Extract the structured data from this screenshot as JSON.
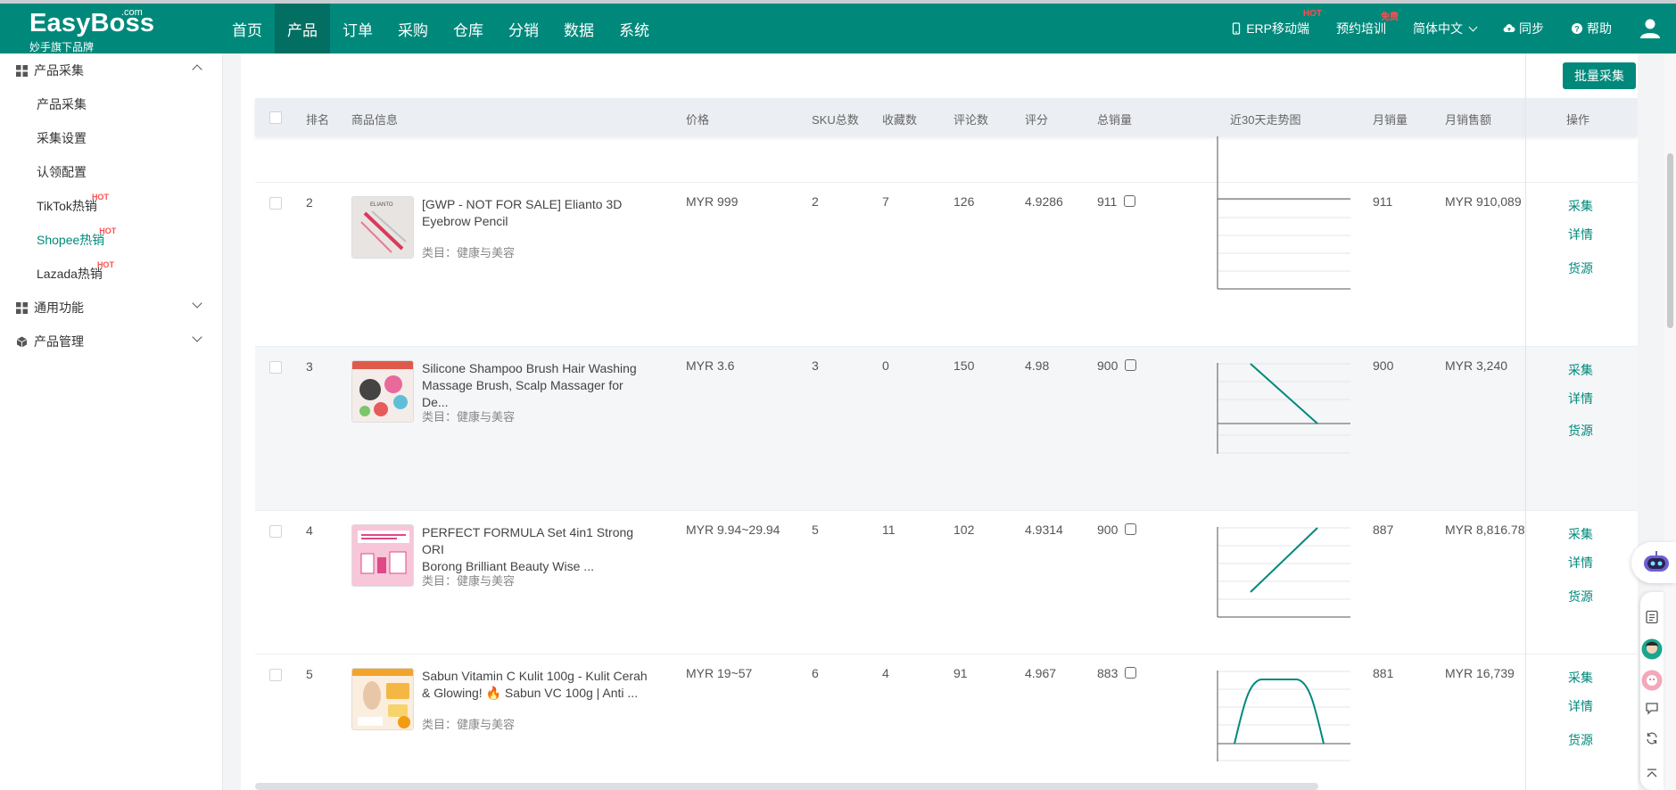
{
  "logo": {
    "brand": "EasyBoss",
    "dotcom": ".com",
    "slogan": "妙手旗下品牌"
  },
  "nav": [
    "首页",
    "产品",
    "订单",
    "采购",
    "仓库",
    "分销",
    "数据",
    "系统"
  ],
  "nav_active": "产品",
  "top_right": {
    "erp": "ERP移动端",
    "erp_badge": "HOT",
    "training": "预约培训",
    "training_badge": "免费",
    "language": "简体中文",
    "sync": "同步",
    "help": "帮助"
  },
  "sidebar": {
    "group1": "产品采集",
    "items": [
      {
        "label": "产品采集"
      },
      {
        "label": "采集设置"
      },
      {
        "label": "认领配置"
      },
      {
        "label": "TikTok热销",
        "badge": "HOT"
      },
      {
        "label": "Shopee热销",
        "badge": "HOT"
      },
      {
        "label": "Lazada热销",
        "badge": "HOT"
      }
    ],
    "group2": "通用功能",
    "group3": "产品管理"
  },
  "toolbar": {
    "batch_label": "批量采集"
  },
  "table": {
    "headers": {
      "rank": "排名",
      "info": "商品信息",
      "price": "价格",
      "sku": "SKU总数",
      "fav": "收藏数",
      "reviews": "评论数",
      "rating": "评分",
      "total_sales": "总销量",
      "trend": "近30天走势图",
      "monthly_sales": "月销量",
      "monthly_revenue": "月销售额",
      "ops": "操作"
    },
    "ops": {
      "collect": "采集",
      "detail": "详情",
      "source": "货源"
    },
    "category_prefix": "类目：",
    "rows": [
      {
        "rank": "2",
        "title1": "[GWP - NOT FOR SALE] Elianto 3D",
        "title2": "Eyebrow Pencil",
        "category": "健康与美容",
        "price": "MYR 999",
        "sku": "2",
        "fav": "7",
        "reviews": "126",
        "rating": "4.9286",
        "total_sales": "911",
        "monthly_sales": "911",
        "monthly_revenue": "MYR 910,089"
      },
      {
        "rank": "3",
        "title1": "Silicone Shampoo Brush Hair Washing",
        "title2": "Massage Brush, Scalp Massager for De...",
        "category": "健康与美容",
        "price": "MYR 3.6",
        "sku": "3",
        "fav": "0",
        "reviews": "150",
        "rating": "4.98",
        "total_sales": "900",
        "monthly_sales": "900",
        "monthly_revenue": "MYR 3,240"
      },
      {
        "rank": "4",
        "title1": "PERFECT FORMULA Set 4in1 Strong ORI",
        "title2": "Borong Brilliant Beauty Wise ...",
        "category": "健康与美容",
        "price": "MYR 9.94~29.94",
        "sku": "5",
        "fav": "11",
        "reviews": "102",
        "rating": "4.9314",
        "total_sales": "900",
        "monthly_sales": "887",
        "monthly_revenue": "MYR 8,816.78"
      },
      {
        "rank": "5",
        "title1": "Sabun Vitamin C Kulit 100g - Kulit Cerah",
        "title2": "& Glowing! 🔥 Sabun VC 100g | Anti ...",
        "category": "健康与美容",
        "price": "MYR 19~57",
        "sku": "6",
        "fav": "4",
        "reviews": "91",
        "rating": "4.967",
        "total_sales": "883",
        "monthly_sales": "881",
        "monthly_revenue": "MYR 16,739"
      }
    ]
  },
  "colors": {
    "primary": "#00897b",
    "primary_dark": "#036e62",
    "hot": "#ff4d4f"
  }
}
